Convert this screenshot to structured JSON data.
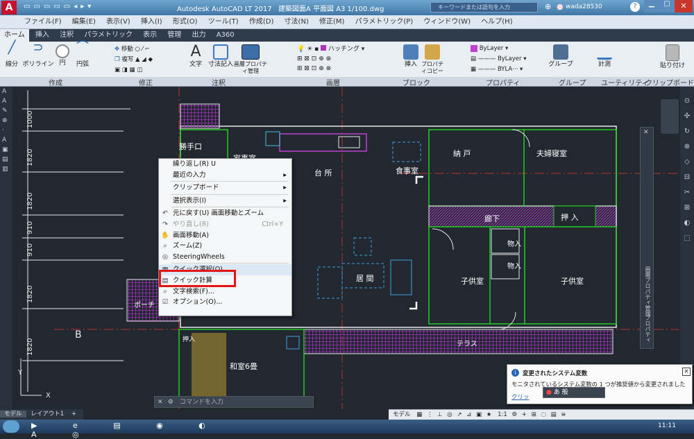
{
  "title": {
    "app": "Autodesk AutoCAD LT 2017",
    "doc": "建築図面A 平面図 A3 1/100.dwg",
    "search_placeholder": "キーワードまたは語句を入力",
    "user": "wada28530"
  },
  "menu": [
    "ファイル(F)",
    "編集(E)",
    "表示(V)",
    "挿入(I)",
    "形式(O)",
    "ツール(T)",
    "作成(D)",
    "寸法(N)",
    "修正(M)",
    "パラメトリック(P)",
    "ウィンドウ(W)",
    "ヘルプ(H)"
  ],
  "tabs": [
    "ホーム",
    "挿入",
    "注釈",
    "パラメトリック",
    "表示",
    "管理",
    "出力",
    "A360"
  ],
  "ribbon": {
    "tools": [
      "線分",
      "ポリライン",
      "円",
      "円弧",
      "移動",
      "複写",
      "文字",
      "寸法記入",
      "画層プロパティ管理",
      "挿入",
      "プロパティコピー",
      "グループ",
      "計測",
      "貼り付け"
    ],
    "small": [
      "移動",
      "複写"
    ],
    "hatch_label": "ハッチング",
    "bylayer1": "ByLayer",
    "bylayer2": "ByLayer",
    "bylayer3": "BYLA···"
  },
  "panels": [
    "作成",
    "修正",
    "注釈",
    "画層",
    "ブロック",
    "プロパティ",
    "グループ",
    "ユーティリティ",
    "クリップボード"
  ],
  "drawing": {
    "dims": [
      "1000",
      "1820",
      "1820",
      "910",
      "910",
      "1820",
      "1820"
    ],
    "rooms": [
      "勝手口",
      "家事室",
      "台 所",
      "食事室",
      "納 戸",
      "夫婦寝室",
      "廊下",
      "押 入",
      "物入",
      "物入",
      "居 間",
      "子供室",
      "子供室",
      "和室6畳",
      "押入",
      "テラス",
      "ポーチ"
    ],
    "grid_b": "B",
    "grid_y": "Y",
    "grid_x": "X"
  },
  "context_menu": {
    "items": [
      {
        "label": "繰り返し(R) U",
        "key": ""
      },
      {
        "label": "最近の入力",
        "key": "▸"
      },
      {
        "label": "クリップボード",
        "key": "▸"
      },
      {
        "label": "選択表示(I)",
        "key": "▸"
      },
      {
        "label": "元に戻す(U) 画面移動とズーム",
        "key": ""
      },
      {
        "label": "やり直し(R)",
        "key": "Ctrl+Y"
      },
      {
        "label": "画面移動(A)",
        "key": ""
      },
      {
        "label": "ズーム(Z)",
        "key": ""
      },
      {
        "label": "SteeringWheels",
        "key": ""
      },
      {
        "label": "クイック選択(Q)...",
        "key": ""
      },
      {
        "label": "クイック計算",
        "key": ""
      },
      {
        "label": "文字検索(F)...",
        "key": ""
      },
      {
        "label": "オプション(O)...",
        "key": ""
      }
    ]
  },
  "notification": {
    "title": "変更されたシステム変数",
    "body": "モニタされているシステム変数の 1 つが推奨値から変更されました",
    "link": "クリッ"
  },
  "command_line": {
    "placeholder": "コマンドを入力"
  },
  "ime_label": "あ 般",
  "layout_tabs": [
    "モデル",
    "レイアウト1"
  ],
  "status": {
    "model_label": "モデル",
    "scale": "1:1"
  },
  "right_palette": {
    "label1": "画層プロパティ管理",
    "label2": "プロパティ"
  },
  "taskbar": {
    "time": "11:11"
  }
}
